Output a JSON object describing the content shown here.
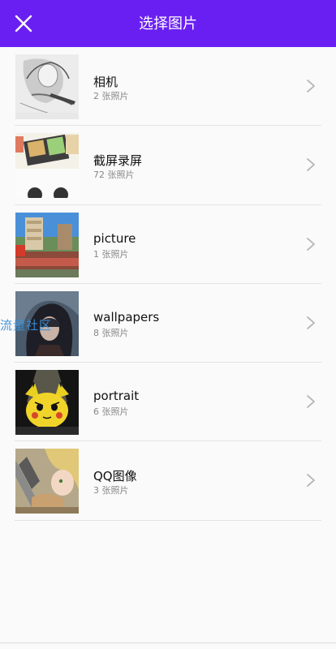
{
  "header": {
    "title": "选择图片",
    "close_icon": "close-icon",
    "background": "#6a1ff2"
  },
  "albums": [
    {
      "name": "相机",
      "count": "2 张照片",
      "thumb": "sketch-portrait"
    },
    {
      "name": "截屏录屏",
      "count": "72 张照片",
      "thumb": "screenshot"
    },
    {
      "name": "picture",
      "count": "1 张照片",
      "thumb": "city-scene"
    },
    {
      "name": "wallpapers",
      "count": "8 张照片",
      "thumb": "hooded-figure"
    },
    {
      "name": "portrait",
      "count": "6 张照片",
      "thumb": "pikachu"
    },
    {
      "name": "QQ图像",
      "count": "3 张照片",
      "thumb": "anime-character"
    }
  ],
  "watermark": "流量社区"
}
